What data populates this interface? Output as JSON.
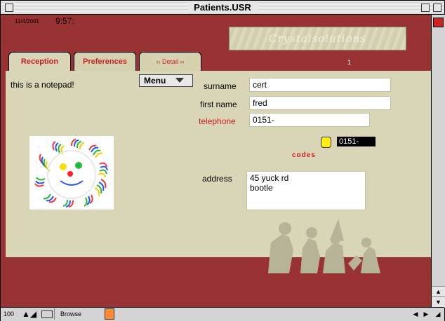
{
  "window": {
    "title": "Patients.USR"
  },
  "header": {
    "date": "11/4/2001",
    "time": "9:57:",
    "logo_text": "Crystalsolutions",
    "page_number": "1"
  },
  "tabs": [
    {
      "label": "Reception",
      "active": true
    },
    {
      "label": "Preferences",
      "active": false
    },
    {
      "label": "‹‹ Detail ››",
      "active": false
    }
  ],
  "form": {
    "notepad": "this is a notepad!",
    "menu_label": "Menu",
    "surname": {
      "label": "surname",
      "value": "cert"
    },
    "first_name": {
      "label": "first name",
      "value": "fred"
    },
    "telephone": {
      "label": "telephone",
      "value": "0151-"
    },
    "codes": {
      "label": "codes",
      "value": "0151-"
    },
    "address": {
      "label": "address",
      "value": "45 yuck rd\nbootle"
    }
  },
  "statusbar": {
    "zoom": "100",
    "mode": "Browse"
  },
  "colors": {
    "frame": "#993333",
    "panel": "#d9d6b8",
    "tab_text": "#cc1f1f",
    "telephone_label": "#cc1f1f"
  },
  "icons": [
    "close-box-icon",
    "zoom-box-icon",
    "collapse-box-icon",
    "scroll-up-arrow-icon",
    "scroll-down-arrow-icon",
    "scroll-left-arrow-icon",
    "scroll-right-arrow-icon",
    "resize-grip-icon",
    "chevron-down-icon"
  ]
}
